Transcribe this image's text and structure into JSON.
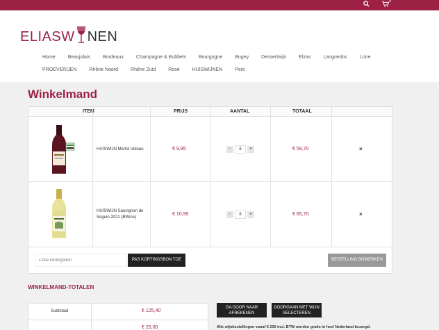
{
  "topbar": {
    "cart_count": "0"
  },
  "logo": {
    "part1": "ELIASW",
    "part2": "NEN"
  },
  "nav": {
    "row1": [
      "Home",
      "Beaujolais",
      "Bordeaux",
      "Champagne & Bubbels",
      "Bourgogne",
      "Bugey",
      "Dessertwijn",
      "Elzas",
      "Languedoc",
      "Loire"
    ],
    "row2": [
      "PROEVERIJEN",
      "Rhône Noord",
      "Rhône Zuid",
      "Rosé",
      "HUISWIJNEN",
      "Pers"
    ]
  },
  "page": {
    "title": "Winkelmand"
  },
  "cart": {
    "headers": {
      "item": "ITEM",
      "price": "PRIJS",
      "qty": "AANTAL",
      "total": "TOTAAL"
    },
    "items": [
      {
        "name": "HUISWIJN Merlot Videau",
        "price": "€ 9,95",
        "qty": "6",
        "total": "€ 59,70",
        "remove": "×",
        "minus": "-",
        "plus": "+",
        "wine_color": "red"
      },
      {
        "name": "HUISWIJN Sauvignon de Seguin 2021 (BWine)",
        "price": "€ 10,95",
        "qty": "6",
        "total": "€ 65,70",
        "remove": "×",
        "minus": "-",
        "plus": "+",
        "wine_color": "white"
      }
    ],
    "coupon_placeholder": "Code kortingsbon",
    "apply_coupon": "PAS KORTINGSBON TOE",
    "update_cart": "BESTELLING BIJWERKEN"
  },
  "totals": {
    "title": "WINKELMAND-TOTALEN",
    "subtotal_label": "Subtotaal",
    "subtotal_value": "€ 125,40",
    "shipping_value": "€ 25,00",
    "checkout_button": "GA DOOR NAAR AFREKENEN",
    "continue_button": "DOORGAAN MET WIJN SELECTEREN",
    "note": "Alle wijnbestellingen vanaf € 200 incl. BTW worden gratis in heel Nederland bezorgd."
  },
  "colors": {
    "brand": "#9c2145"
  }
}
